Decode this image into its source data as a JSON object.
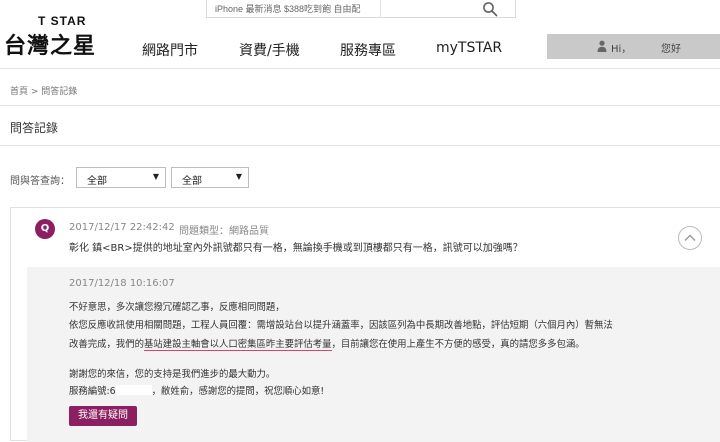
{
  "header": {
    "search_placeholder": "iPhone 最新消息   $388吃到飽   自由配",
    "logo_sub": "T STAR",
    "logo_main": "台灣之星",
    "nav": [
      "網路門市",
      "資費/手機",
      "服務專區",
      "myTSTAR"
    ],
    "user": {
      "hi": "Hi，",
      "greeting": "您好"
    }
  },
  "breadcrumb": "首頁 > 問答記錄",
  "page_title": "問答記錄",
  "filter": {
    "label": "問與答查詢：",
    "select1_value": "全部",
    "select2_value": "全部"
  },
  "question": {
    "badge": "Q",
    "time": "2017/12/17 22:42:42",
    "type": "問題類型：網路品質",
    "text": "彰化          鎮<BR>提供的地址室內外訊號都只有一格，無論換手機或到頂樓都只有一格，訊號可以加強嗎？"
  },
  "answer": {
    "time": "2017/12/18 10:16:07",
    "l1": "不好意思，多次讓您撥冗確認乙事，反應相同問題，",
    "l2": "依您反應收訊使用相關問題，工程人員回覆：需增設站台以提升涵蓋率，因該區列為中長期改善地點，評估短期（六個月內）暫無法",
    "l3a": "改善完成，我們的",
    "l3b": "基站建設主軸會以人口密集區昨主要評估考量",
    "l3c": "，目前讓您在使用上產生不方便的感受，真的請您多多包涵。",
    "l4": "謝謝您的來信，您的支持是我們進步的最大動力。",
    "l5a": "服務編號:6",
    "l5b": "，敝姓俞，感謝您的提問，祝您順心如意!",
    "button": "我還有疑問"
  },
  "colors": {
    "brand": "#8b1f61",
    "user_bar": "#c9c9c9",
    "answer_bg": "#f3f3f3"
  }
}
